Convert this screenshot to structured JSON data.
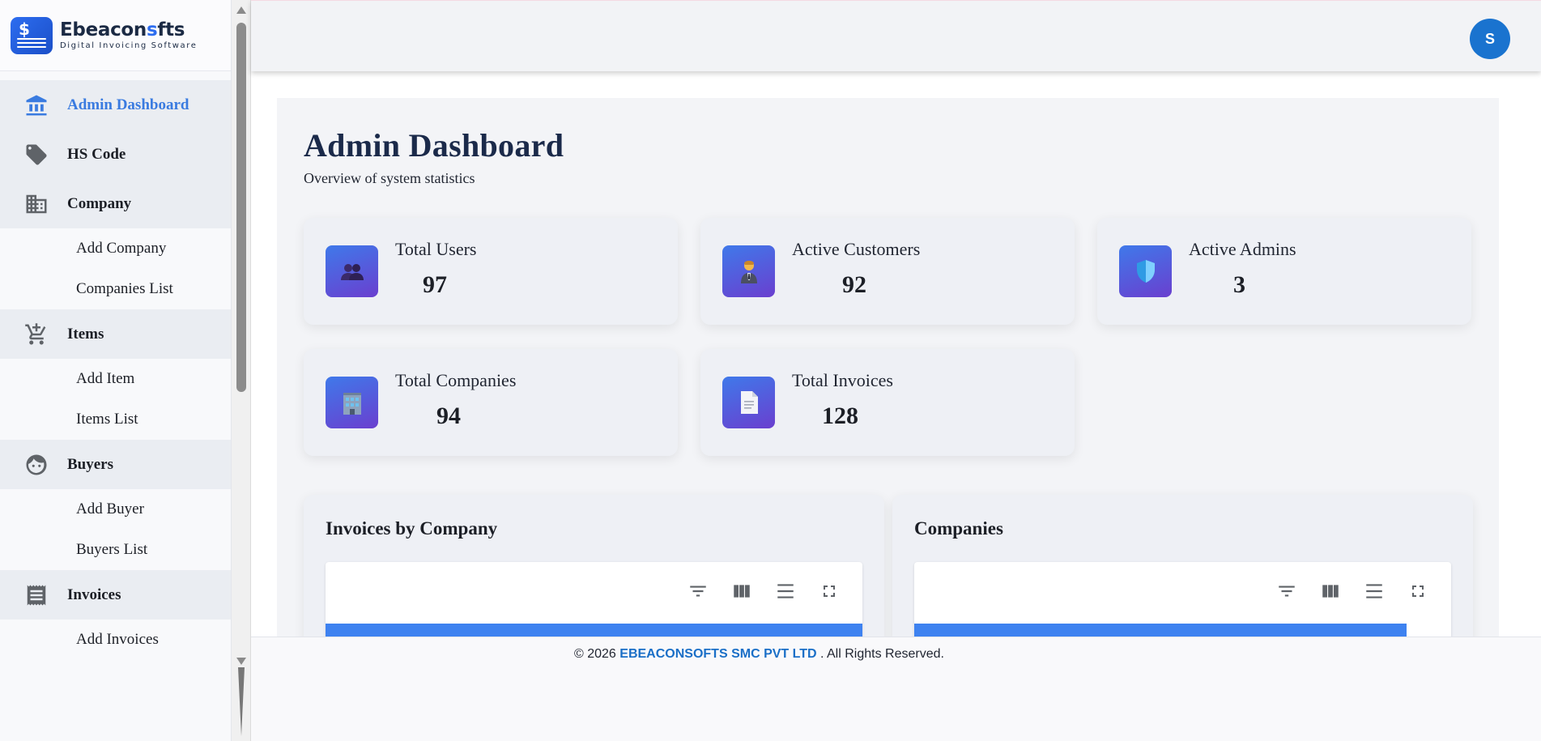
{
  "brand": {
    "name_main": "Ebeacon",
    "name_accent": "s",
    "name_rest": "fts",
    "tagline": "Digital Invoicing Software",
    "logo_symbol": "$"
  },
  "sidebar": {
    "items": [
      {
        "label": "Admin Dashboard",
        "icon": "bank-icon",
        "active": true
      },
      {
        "label": "HS Code",
        "icon": "tag-icon"
      },
      {
        "label": "Company",
        "icon": "building-icon"
      },
      {
        "label": "Add Company"
      },
      {
        "label": "Companies List"
      },
      {
        "label": "Items",
        "icon": "cart-icon"
      },
      {
        "label": "Add Item"
      },
      {
        "label": "Items List"
      },
      {
        "label": "Buyers",
        "icon": "face-icon"
      },
      {
        "label": "Add Buyer"
      },
      {
        "label": "Buyers List"
      },
      {
        "label": "Invoices",
        "icon": "receipt-icon"
      },
      {
        "label": "Add Invoices"
      }
    ]
  },
  "header": {
    "avatar_initial": "S"
  },
  "main": {
    "title": "Admin Dashboard",
    "subtitle": "Overview of system statistics",
    "stats": [
      {
        "label": "Total Users",
        "value": "97",
        "icon": "users-emoji-icon",
        "emoji": "👥"
      },
      {
        "label": "Active Customers",
        "value": "92",
        "icon": "person-emoji-icon",
        "emoji": "🧑‍💼"
      },
      {
        "label": "Active Admins",
        "value": "3",
        "icon": "shield-emoji-icon",
        "emoji": "🛡️"
      },
      {
        "label": "Total Companies",
        "value": "94",
        "icon": "office-emoji-icon",
        "emoji": "🏢"
      },
      {
        "label": "Total Invoices",
        "value": "128",
        "icon": "document-emoji-icon",
        "emoji": "📄"
      }
    ],
    "panels": [
      {
        "title": "Invoices by Company"
      },
      {
        "title": "Companies"
      }
    ]
  },
  "footer": {
    "prefix": "© 2026 ",
    "company": "EBEACONSOFTS SMC PVT LTD",
    "suffix": " . All Rights Reserved."
  },
  "colors": {
    "accent": "#3a7be0",
    "avatar": "#1a73cf",
    "stat_icon_gradient": [
      "#3f79ea",
      "#6a3fcf"
    ],
    "chart_bar": "#3e82f0",
    "footer_brand": "#1a6fc7"
  }
}
